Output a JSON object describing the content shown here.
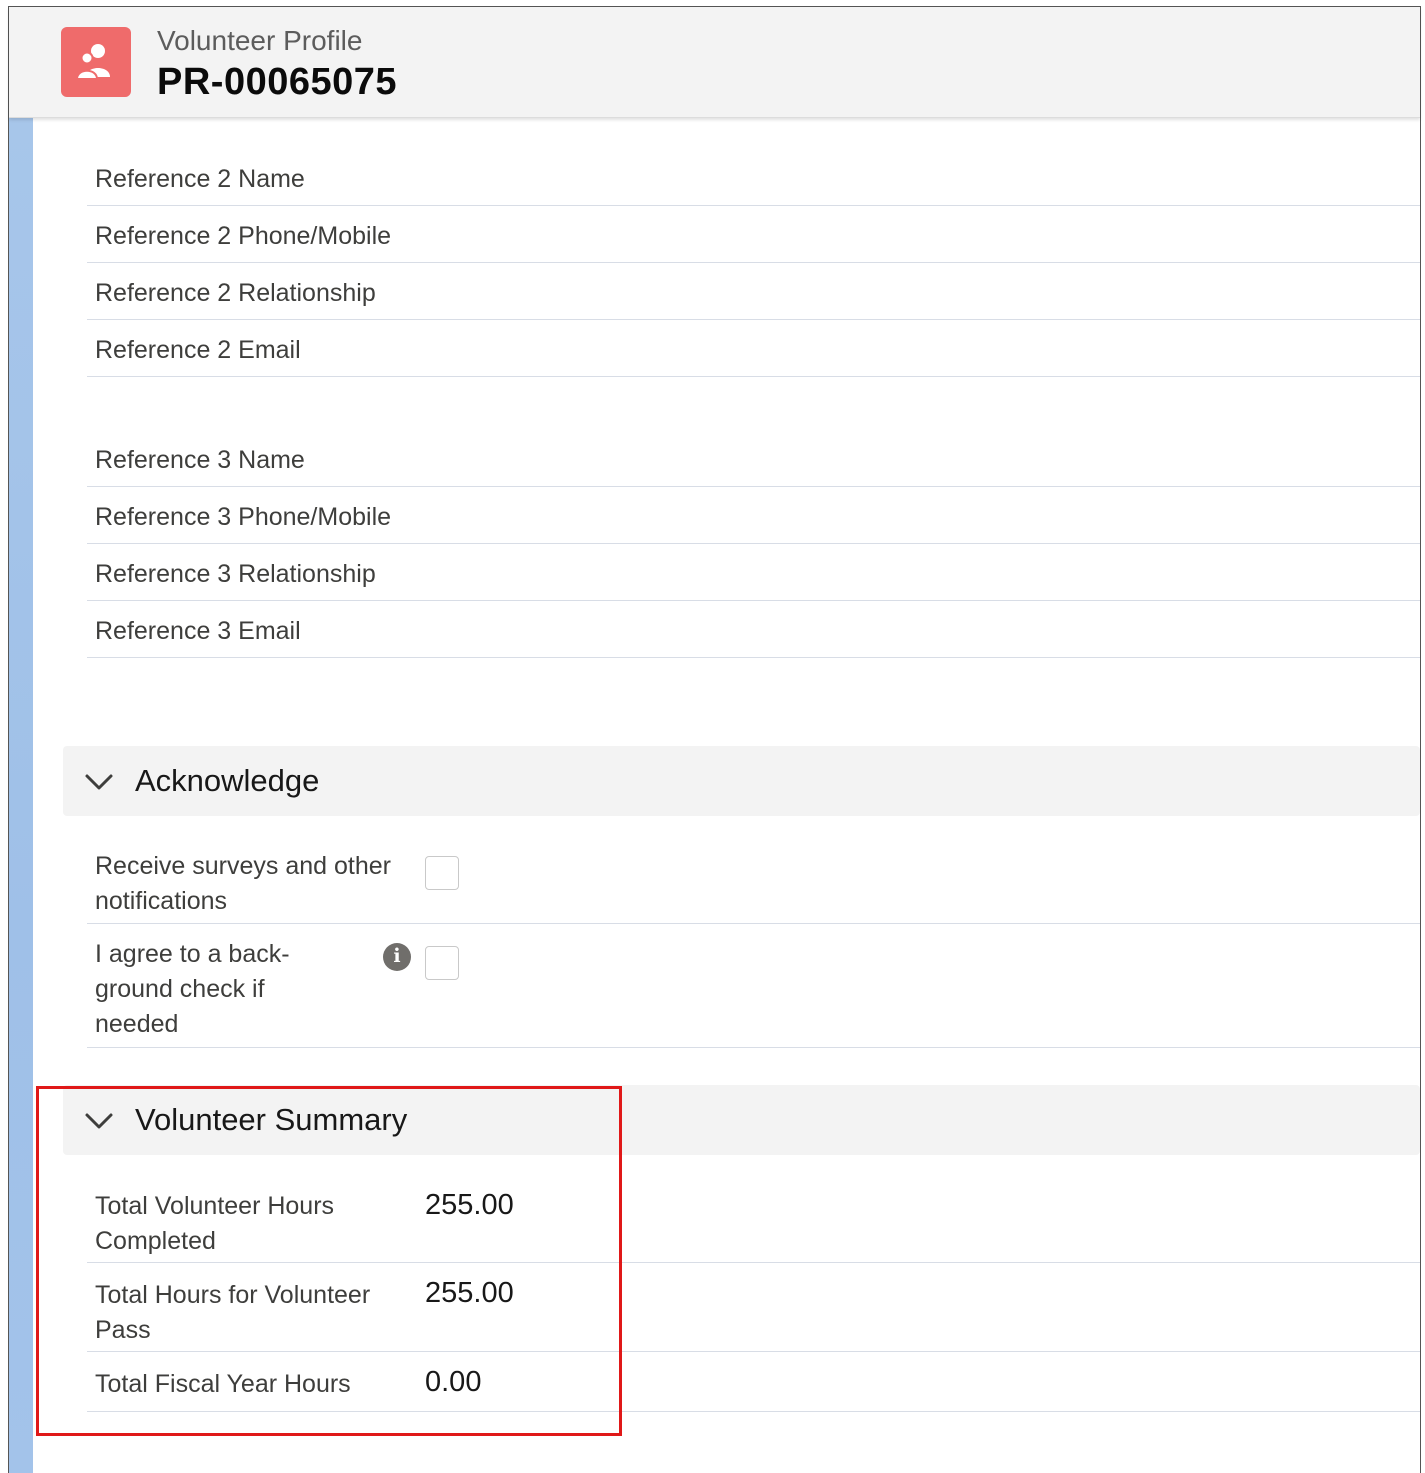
{
  "header": {
    "object_type": "Volunteer Profile",
    "record_name": "PR-00065075",
    "icon": "volunteer-profile-icon",
    "icon_color": "#ef6b6b"
  },
  "references": [
    {
      "label": "Reference 2 Name"
    },
    {
      "label": "Reference 2 Phone/Mobile"
    },
    {
      "label": "Reference 2 Relationship"
    },
    {
      "label": "Reference 2 Email"
    },
    {
      "label": "Reference 3 Name"
    },
    {
      "label": "Reference 3 Phone/Mobile"
    },
    {
      "label": "Reference 3 Relationship"
    },
    {
      "label": "Reference 3 Email"
    }
  ],
  "acknowledge": {
    "title": "Acknowledge",
    "expanded": true,
    "fields": [
      {
        "label": "Receive surveys and other notifications",
        "checked": false,
        "info_icon": false
      },
      {
        "label": "I agree to a back-ground check if needed",
        "checked": false,
        "info_icon": true
      }
    ]
  },
  "volunteer_summary": {
    "title": "Volunteer Summary",
    "expanded": true,
    "highlight_color": "#e01818",
    "fields": [
      {
        "label": "Total Volunteer Hours Completed",
        "value": "255.00"
      },
      {
        "label": "Total Hours for Volunteer Pass",
        "value": "255.00"
      },
      {
        "label": "Total Fiscal Year Hours",
        "value": "0.00"
      }
    ]
  }
}
